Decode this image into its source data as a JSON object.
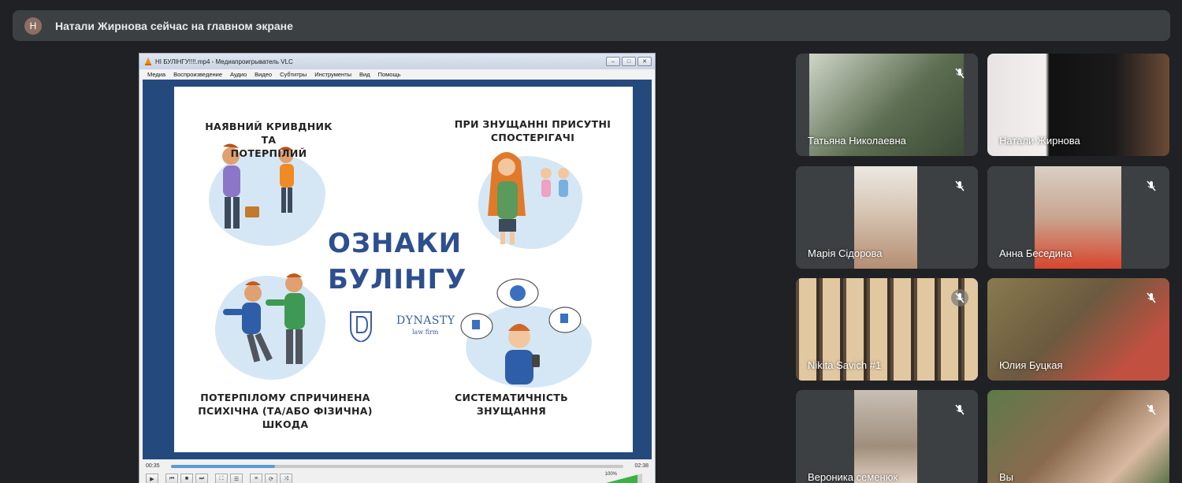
{
  "banner": {
    "avatar_letter": "Н",
    "text": "Натали Жирнова сейчас на главном экране"
  },
  "vlc": {
    "title": "НІ БУЛІНГУ!!!!.mp4 - Медиапроигрыватель VLC",
    "menu": [
      "Медиа",
      "Воспроизведение",
      "Аудио",
      "Видео",
      "Субтитры",
      "Инструменты",
      "Вид",
      "Помощь"
    ],
    "time_elapsed": "00:35",
    "time_total": "02:38",
    "playback_progress": 0.23,
    "volume_label": "100%"
  },
  "slide": {
    "title_line1": "ОЗНАКИ",
    "title_line2": "БУЛІНГУ",
    "sign1": [
      "НАЯВНИЙ КРИВДНИК ТА",
      "ПОТЕРПІЛИЙ"
    ],
    "sign2": [
      "ПРИ ЗНУЩАННІ ПРИСУТНІ",
      "СПОСТЕРІГАЧІ"
    ],
    "sign3": [
      "ПОТЕРПІЛОМУ СПРИЧИНЕНА",
      "ПСИХІЧНА (ТА/АБО ФІЗИЧНА)",
      "ШКОДА"
    ],
    "sign4": [
      "СИСТЕМАТИЧНІСТЬ",
      "ЗНУЩАННЯ"
    ],
    "logo_name": "DYNASTY",
    "logo_sub": "law firm"
  },
  "participants": [
    {
      "name": "Татьяна Николаевна",
      "muted": true,
      "bg": "#5d6e52"
    },
    {
      "name": "Натали Жирнова",
      "muted": false,
      "bg": "#1a1a1a"
    },
    {
      "name": "Марія Сідорова",
      "muted": true,
      "bg": "#d9c9b8"
    },
    {
      "name": "Анна Беседина",
      "muted": true,
      "bg": "#c9a590"
    },
    {
      "name": "Nikita Savich #1",
      "muted": true,
      "bg": "#8c7a66"
    },
    {
      "name": "Юлия Буцкая",
      "muted": true,
      "bg": "#6b5a3f"
    },
    {
      "name": "Вероника семенюк",
      "muted": true,
      "bg": "#a08e7c"
    },
    {
      "name": "Вы",
      "muted": true,
      "bg": "#8a6a4e"
    }
  ],
  "colors": {
    "meet_bg": "#202124",
    "tile_bg": "#3c4043",
    "active_outline": "#8ab4f8",
    "slide_title": "#2d4f8f"
  }
}
